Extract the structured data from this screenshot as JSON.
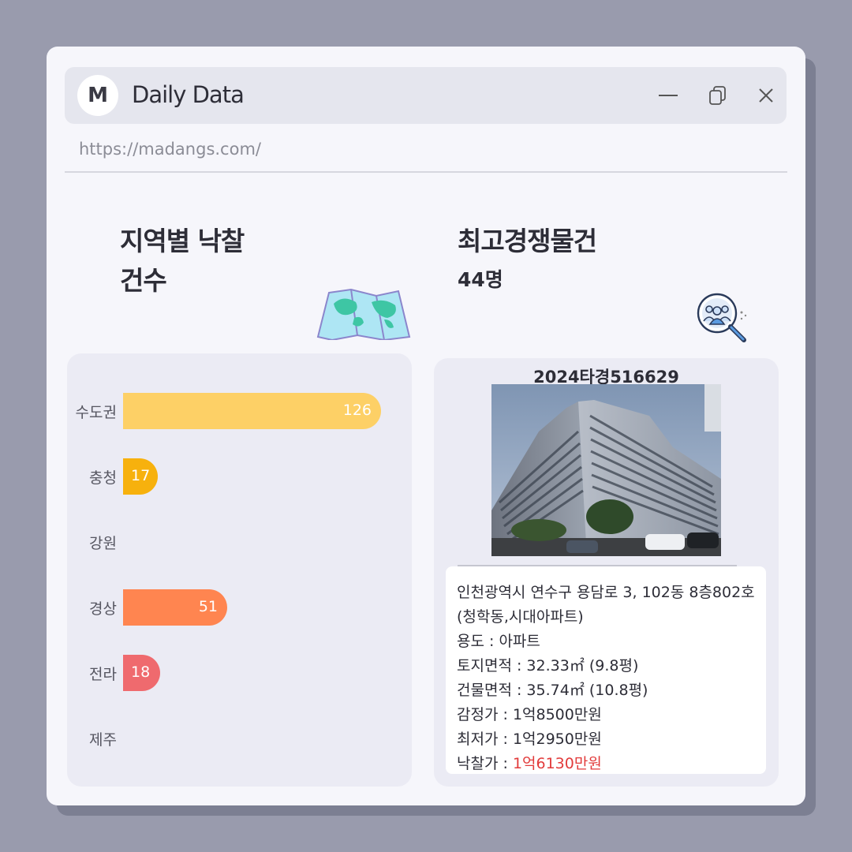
{
  "window": {
    "logo_letter": "M",
    "title": "Daily Data",
    "url": "https://madangs.com/"
  },
  "left": {
    "title_line1": "지역별 낙찰",
    "title_line2": "건수",
    "icon": "map-icon"
  },
  "right": {
    "title": "최고경쟁물건",
    "subtitle": "44명",
    "icon": "people-search-icon"
  },
  "chart_data": {
    "type": "bar",
    "orientation": "horizontal",
    "categories": [
      "수도권",
      "충청",
      "강원",
      "경상",
      "전라",
      "제주"
    ],
    "values": [
      126,
      17,
      null,
      51,
      18,
      null
    ],
    "value_labels": [
      "126",
      "17",
      "",
      "51",
      "18",
      ""
    ],
    "colors": [
      "#fdd066",
      "#f7b10d",
      "#cccccc",
      "#ff8550",
      "#ef6a6e",
      "#cccccc"
    ],
    "xlim": [
      0,
      140
    ]
  },
  "property": {
    "case_no": "2024타경516629",
    "address_line1": "인천광역시 연수구 용담로 3, 102동 8층802호",
    "address_line2": "(청학동,시대아파트)",
    "usage_label": "용도 :",
    "usage": "아파트",
    "land_label": "토지면적 :",
    "land": "32.33㎡ (9.8평)",
    "building_label": "건물면적 :",
    "building": "35.74㎡ (10.8평)",
    "appraisal_label": "감정가 :",
    "appraisal": "1억8500만원",
    "minimum_label": "최저가 :",
    "minimum": "1억2950만원",
    "winning_label": "낙찰가 :",
    "winning": "1억6130만원",
    "winning_color": "#e23b3b"
  }
}
